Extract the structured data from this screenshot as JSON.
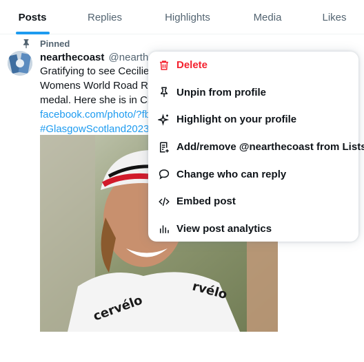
{
  "tabs": [
    {
      "label": "Posts",
      "active": true
    },
    {
      "label": "Replies"
    },
    {
      "label": "Highlights"
    },
    {
      "label": "Media"
    },
    {
      "label": "Likes"
    }
  ],
  "pinned_label": "Pinned",
  "post": {
    "author_name": "nearthecoast",
    "author_handle": "@nearthec",
    "lines": [
      "Gratifying to see Cecilie U",
      "Womens World Road Rac",
      "medal.  Here she is in Chu"
    ],
    "link": "facebook.com/photo/?fb",
    "hashtag": "#GlasgowScotland2023"
  },
  "menu": {
    "items": [
      {
        "label": "Delete",
        "icon": "trash-icon",
        "danger": true
      },
      {
        "label": "Unpin from profile",
        "icon": "pin-icon"
      },
      {
        "label": "Highlight on your profile",
        "icon": "sparkle-icon"
      },
      {
        "label": "Add/remove @nearthecoast from Lists",
        "icon": "list-add-icon"
      },
      {
        "label": "Change who can reply",
        "icon": "speech-bubble-icon"
      },
      {
        "label": "Embed post",
        "icon": "code-icon"
      },
      {
        "label": "View post analytics",
        "icon": "analytics-icon"
      }
    ]
  },
  "colors": {
    "accent": "#1d9bf0",
    "danger": "#f4212e",
    "text": "#0f1419",
    "muted": "#536471"
  }
}
